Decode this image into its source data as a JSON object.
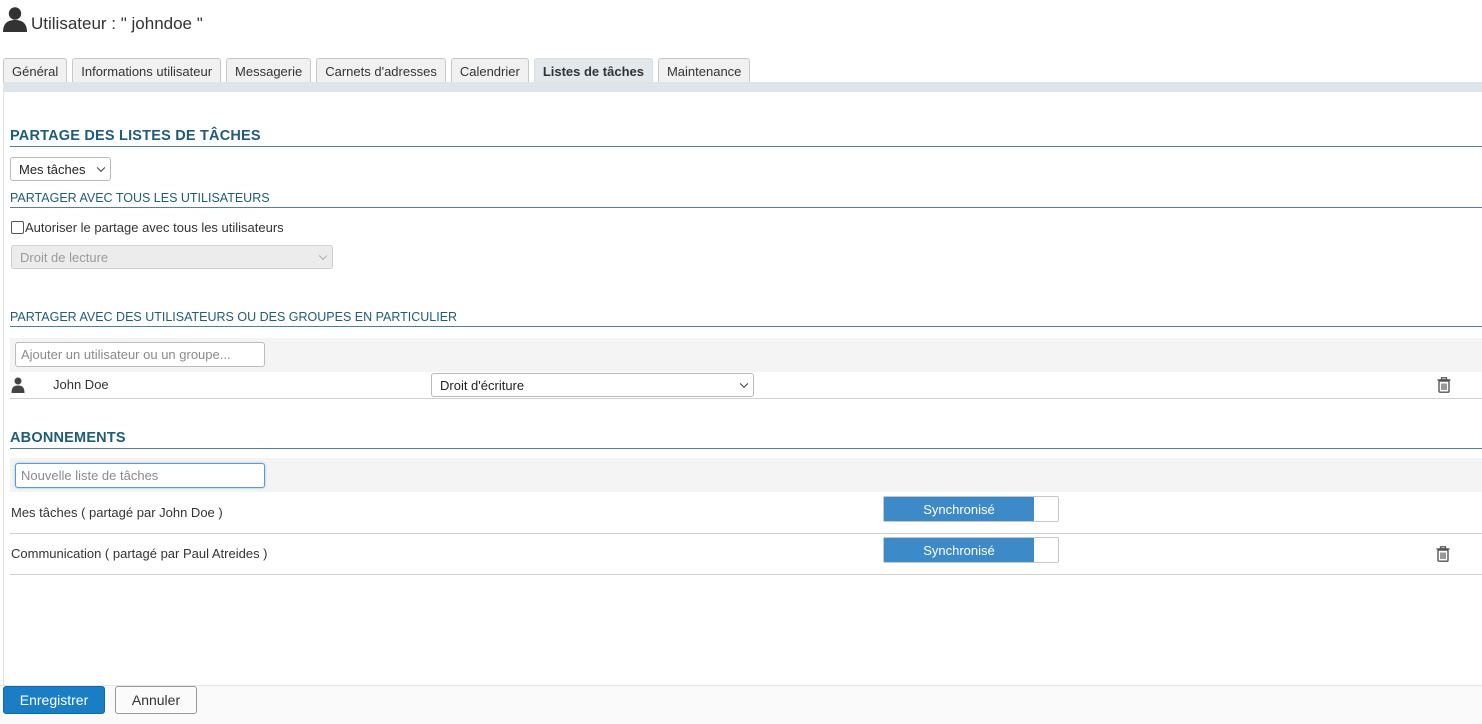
{
  "header": {
    "title": "Utilisateur : \" johndoe \"",
    "icon": "user-icon"
  },
  "tabs": [
    {
      "label": "Général",
      "active": false
    },
    {
      "label": "Informations utilisateur",
      "active": false
    },
    {
      "label": "Messagerie",
      "active": false
    },
    {
      "label": "Carnets d'adresses",
      "active": false
    },
    {
      "label": "Calendrier",
      "active": false
    },
    {
      "label": "Listes de tâches",
      "active": true
    },
    {
      "label": "Maintenance",
      "active": false
    }
  ],
  "sharing": {
    "heading": "PARTAGE DES LISTES DE TÂCHES",
    "list_select": "Mes tâches",
    "all_users": {
      "heading": "PARTAGER AVEC TOUS LES UTILISATEURS",
      "checkbox_label": "Autoriser le partage avec tous les utilisateurs",
      "checked": false,
      "right_select": "Droit de lecture"
    },
    "particular": {
      "heading": "PARTAGER AVEC DES UTILISATEURS OU DES GROUPES EN PARTICULIER",
      "add_placeholder": "Ajouter un utilisateur ou un groupe...",
      "entries": [
        {
          "name": "John Doe",
          "right": "Droit d'écriture",
          "icon": "user-icon"
        }
      ]
    }
  },
  "subscriptions": {
    "heading": "ABONNEMENTS",
    "new_placeholder": "Nouvelle liste de tâches",
    "items": [
      {
        "label": "Mes tâches ( partagé par John Doe )",
        "status": "Synchronisé",
        "deletable": false
      },
      {
        "label": "Communication ( partagé par Paul Atreides )",
        "status": "Synchronisé",
        "deletable": true
      }
    ]
  },
  "footer": {
    "save_label": "Enregistrer",
    "cancel_label": "Annuler"
  },
  "colors": {
    "accent": "#1a7ec4",
    "heading": "#1f5b7a",
    "toggle_on": "#3d8ac9"
  }
}
